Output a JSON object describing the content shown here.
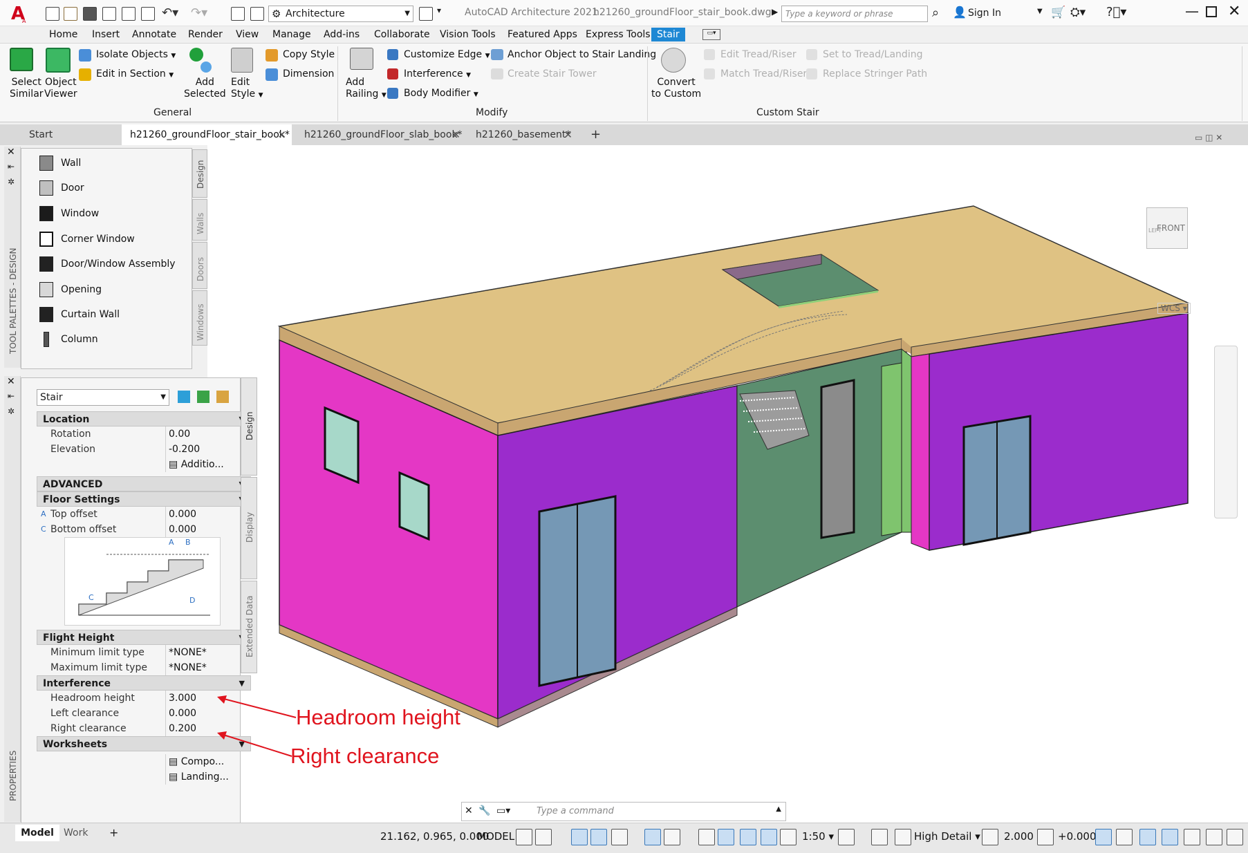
{
  "titlebar": {
    "workspace": "Architecture",
    "app_title": "AutoCAD Architecture 2021",
    "file_name": "h21260_groundFloor_stair_book.dwg",
    "search_placeholder": "Type a keyword or phrase",
    "sign_in": "Sign In"
  },
  "ribbon_tabs": [
    "Home",
    "Insert",
    "Annotate",
    "Render",
    "View",
    "Manage",
    "Add-ins",
    "Collaborate",
    "Vision Tools",
    "Featured Apps",
    "Express Tools",
    "Stair"
  ],
  "ribbon": {
    "general": {
      "select_similar": [
        "Select",
        "Similar"
      ],
      "object_viewer": [
        "Object",
        "Viewer"
      ],
      "isolate_objects": "Isolate Objects",
      "edit_in_section": "Edit in Section",
      "add_selected": [
        "Add",
        "Selected"
      ],
      "edit_style": [
        "Edit",
        "Style"
      ],
      "copy_style": "Copy Style",
      "dimension": "Dimension",
      "section_label": "General"
    },
    "modify": {
      "add_railing": [
        "Add",
        "Railing"
      ],
      "customize_edge": "Customize Edge",
      "interference": "Interference",
      "body_modifier": "Body Modifier",
      "anchor_object": "Anchor Object to Stair Landing",
      "create_stair_tower": "Create Stair Tower",
      "section_label": "Modify"
    },
    "custom": {
      "convert": [
        "Convert",
        "to Custom"
      ],
      "edit_tread": "Edit Tread/Riser",
      "match_tread": "Match Tread/Riser",
      "set_to_tread": "Set to Tread/Landing",
      "replace_stringer": "Replace Stringer Path",
      "section_label": "Custom Stair"
    }
  },
  "doc_tabs": {
    "start": "Start",
    "tab1": "h21260_groundFloor_stair_book*",
    "tab2": "h21260_groundFloor_slab_book*",
    "tab3": "h21260_basement*"
  },
  "palette": {
    "strip_label": "TOOL PALETTES - DESIGN",
    "items": [
      "Wall",
      "Door",
      "Window",
      "Corner Window",
      "Door/Window Assembly",
      "Opening",
      "Curtain Wall",
      "Column"
    ],
    "tabs": [
      "Design",
      "Walls",
      "Doors",
      "Windows"
    ]
  },
  "properties": {
    "strip_label": "PROPERTIES",
    "object_type": "Stair",
    "location_header": "Location",
    "rotation_label": "Rotation",
    "rotation_value": "0.00",
    "elevation_label": "Elevation",
    "elevation_value": "-0.200",
    "additional": "Additio...",
    "advanced_header": "ADVANCED",
    "floor_settings_header": "Floor Settings",
    "top_offset_letter": "A",
    "top_offset_label": "Top offset",
    "top_offset_value": "0.000",
    "bottom_offset_letter": "C",
    "bottom_offset_label": "Bottom offset",
    "bottom_offset_value": "0.000",
    "diagram_labels": [
      "A",
      "B",
      "C",
      "D"
    ],
    "flight_height_header": "Flight Height",
    "min_limit_label": "Minimum limit type",
    "min_limit_value": "*NONE*",
    "max_limit_label": "Maximum limit type",
    "max_limit_value": "*NONE*",
    "interference_header": "Interference",
    "headroom_label": "Headroom height",
    "headroom_value": "3.000",
    "left_clear_label": "Left clearance",
    "left_clear_value": "0.000",
    "right_clear_label": "Right clearance",
    "right_clear_value": "0.200",
    "worksheets_header": "Worksheets",
    "components": "Compo...",
    "landing": "Landing...",
    "side_tabs": [
      "Design",
      "Display",
      "Extended Data"
    ]
  },
  "annotations": {
    "headroom": "Headroom height",
    "right_clearance": "Right clearance"
  },
  "viewport": {
    "viewcube_front": "FRONT",
    "viewcube_left": "LEFT",
    "wcs": "WCS"
  },
  "command": {
    "placeholder": "Type  a  command"
  },
  "status": {
    "tab_model": "Model",
    "tab_work": "Work",
    "coords": "21.162, 0.965, 0.000",
    "space": "MODEL",
    "scale": "1:50",
    "detail": "High Detail",
    "elevation": "2.000",
    "elev_offset": "+0.000"
  }
}
